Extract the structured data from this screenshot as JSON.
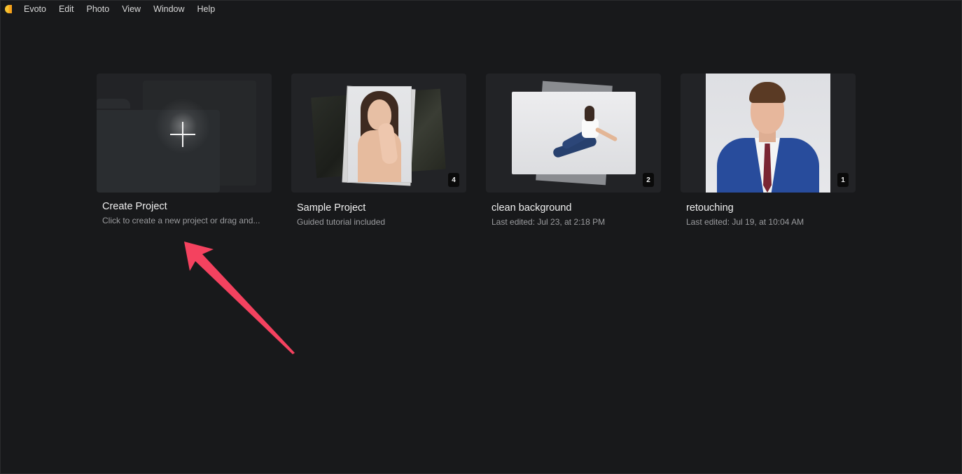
{
  "menubar": {
    "items": [
      "Evoto",
      "Edit",
      "Photo",
      "View",
      "Window",
      "Help"
    ]
  },
  "projects": [
    {
      "title": "Create Project",
      "subtitle": "Click to create a new project or drag and...",
      "badge": null
    },
    {
      "title": "Sample Project",
      "subtitle": "Guided tutorial included",
      "badge": "4"
    },
    {
      "title": "clean background",
      "subtitle": "Last edited: Jul 23, at 2:18 PM",
      "badge": "2"
    },
    {
      "title": "retouching",
      "subtitle": "Last edited: Jul 19, at 10:04 AM",
      "badge": "1"
    }
  ],
  "colors": {
    "background": "#18191b",
    "card": "#222326",
    "arrow": "#f4425f"
  }
}
